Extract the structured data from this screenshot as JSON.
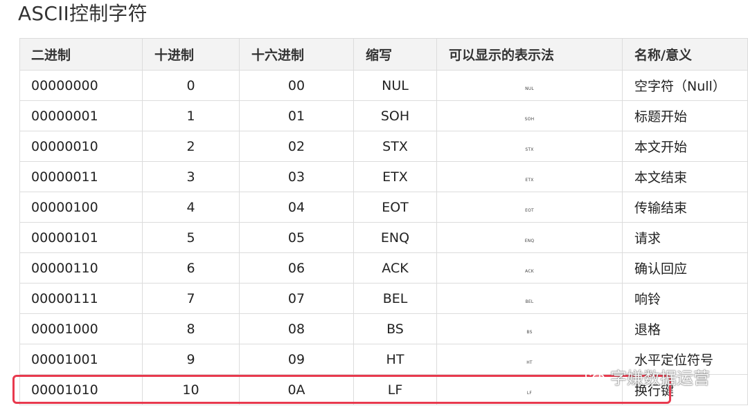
{
  "page": {
    "title": "ASCII控制字符"
  },
  "table": {
    "headers": [
      "二进制",
      "十进制",
      "十六进制",
      "缩写",
      "可以显示的表示法",
      "名称/意义"
    ],
    "rows": [
      {
        "bin": "00000000",
        "dec": "0",
        "hex": "00",
        "abbr": "NUL",
        "symbol": "NUL",
        "name": "空字符（Null）"
      },
      {
        "bin": "00000001",
        "dec": "1",
        "hex": "01",
        "abbr": "SOH",
        "symbol": "SOH",
        "name": "标题开始"
      },
      {
        "bin": "00000010",
        "dec": "2",
        "hex": "02",
        "abbr": "STX",
        "symbol": "STX",
        "name": "本文开始"
      },
      {
        "bin": "00000011",
        "dec": "3",
        "hex": "03",
        "abbr": "ETX",
        "symbol": "ETX",
        "name": "本文结束"
      },
      {
        "bin": "00000100",
        "dec": "4",
        "hex": "04",
        "abbr": "EOT",
        "symbol": "EOT",
        "name": "传输结束"
      },
      {
        "bin": "00000101",
        "dec": "5",
        "hex": "05",
        "abbr": "ENQ",
        "symbol": "ENQ",
        "name": "请求"
      },
      {
        "bin": "00000110",
        "dec": "6",
        "hex": "06",
        "abbr": "ACK",
        "symbol": "ACK",
        "name": "确认回应"
      },
      {
        "bin": "00000111",
        "dec": "7",
        "hex": "07",
        "abbr": "BEL",
        "symbol": "BEL",
        "name": "响铃"
      },
      {
        "bin": "00001000",
        "dec": "8",
        "hex": "08",
        "abbr": "BS",
        "symbol": "BS",
        "name": "退格"
      },
      {
        "bin": "00001001",
        "dec": "9",
        "hex": "09",
        "abbr": "HT",
        "symbol": "HT",
        "name": "水平定位符号"
      },
      {
        "bin": "00001010",
        "dec": "10",
        "hex": "0A",
        "abbr": "LF",
        "symbol": "LF",
        "name": "换行键"
      }
    ]
  },
  "highlight": {
    "color": "#e8394d",
    "row": "00001010"
  },
  "watermark": {
    "text": "字嫌数据运营",
    "icon": "wechat-icon"
  }
}
